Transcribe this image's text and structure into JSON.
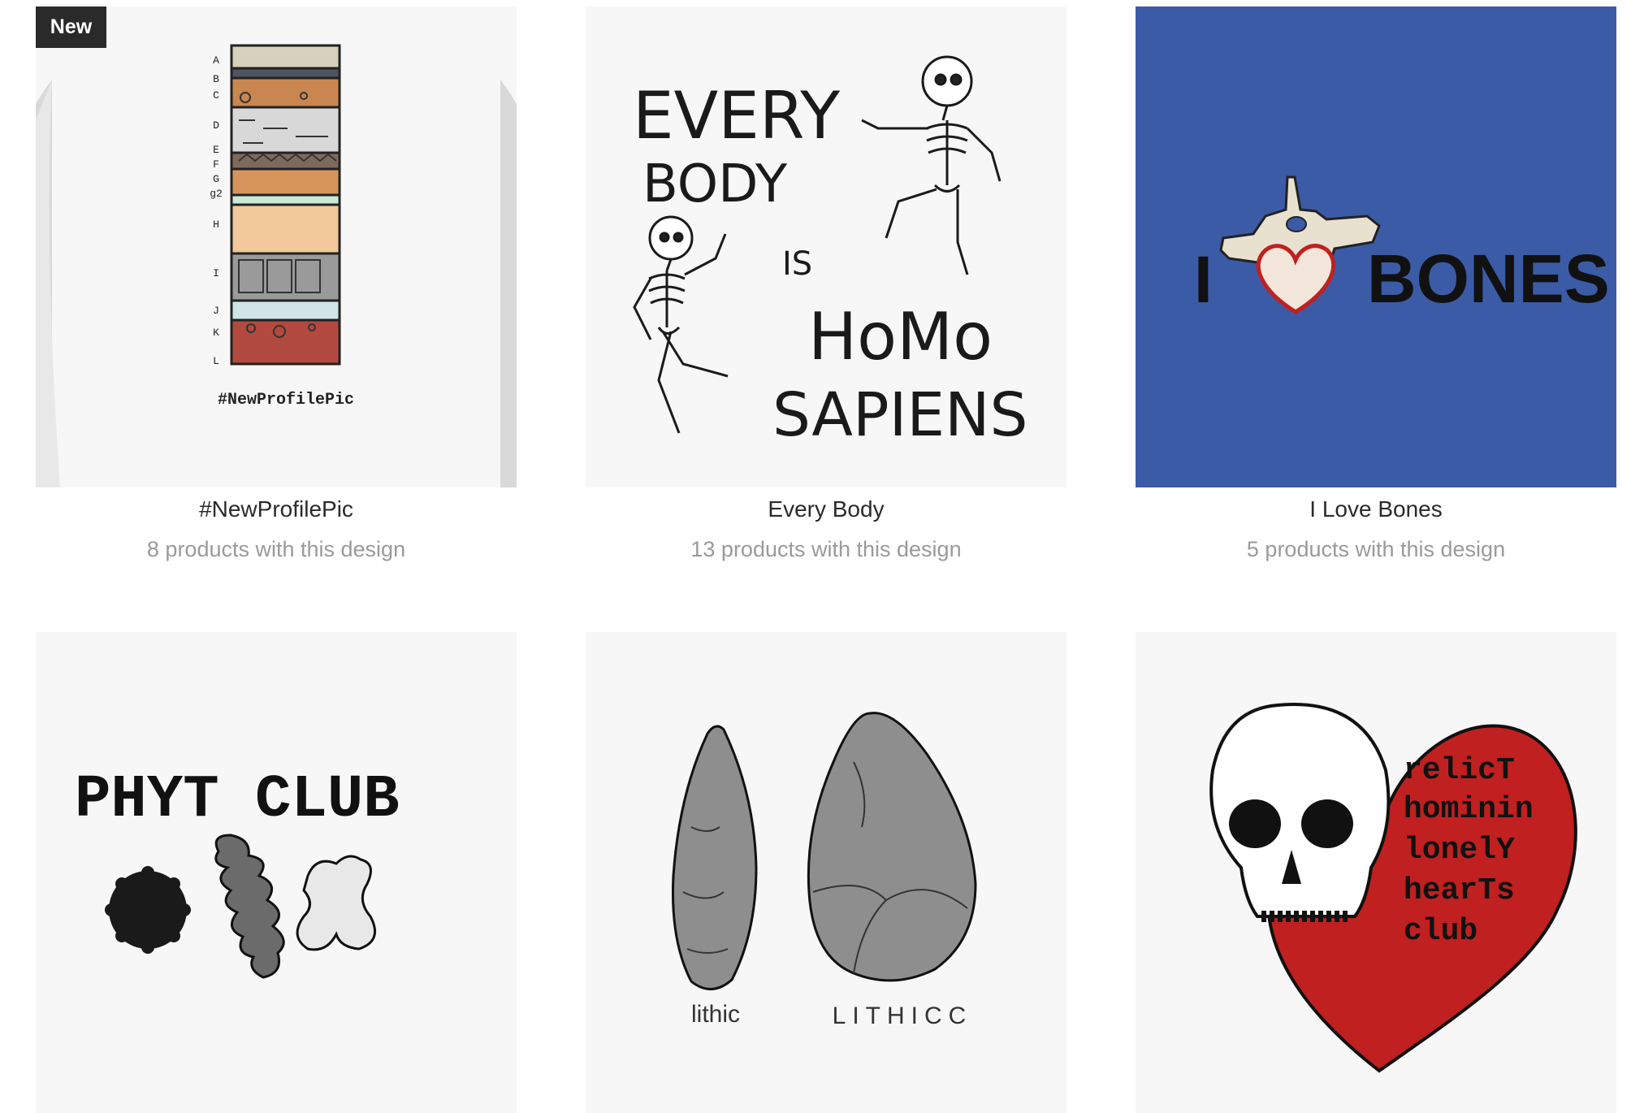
{
  "designs": [
    {
      "badge": "New",
      "title": "#NewProfilePic",
      "subtitle": "8 products with this design",
      "art": {
        "hashtag": "#NewProfilePic",
        "layer_letters": [
          "A",
          "B",
          "C",
          "D",
          "E",
          "F",
          "G",
          "g2",
          "H",
          "I",
          "J",
          "K",
          "L"
        ]
      }
    },
    {
      "title": "Every Body",
      "subtitle": "13 products with this design",
      "art": {
        "lines": [
          "EVERY",
          "BODY",
          "IS",
          "HoMo",
          "SAPIENS"
        ]
      }
    },
    {
      "title": "I Love Bones",
      "subtitle": "5 products with this design",
      "art": {
        "left_text": "I",
        "right_text": "BONES",
        "background": "#3b5ba6"
      }
    },
    {
      "art": {
        "text": "PHYT CLUB"
      }
    },
    {
      "art": {
        "left_label": "lithic",
        "right_label": "LITHICC"
      }
    },
    {
      "art": {
        "lines": [
          "relicT",
          "hominin",
          "lonelY",
          "hearTs",
          "club"
        ],
        "heart_color": "#c0201f"
      }
    }
  ]
}
